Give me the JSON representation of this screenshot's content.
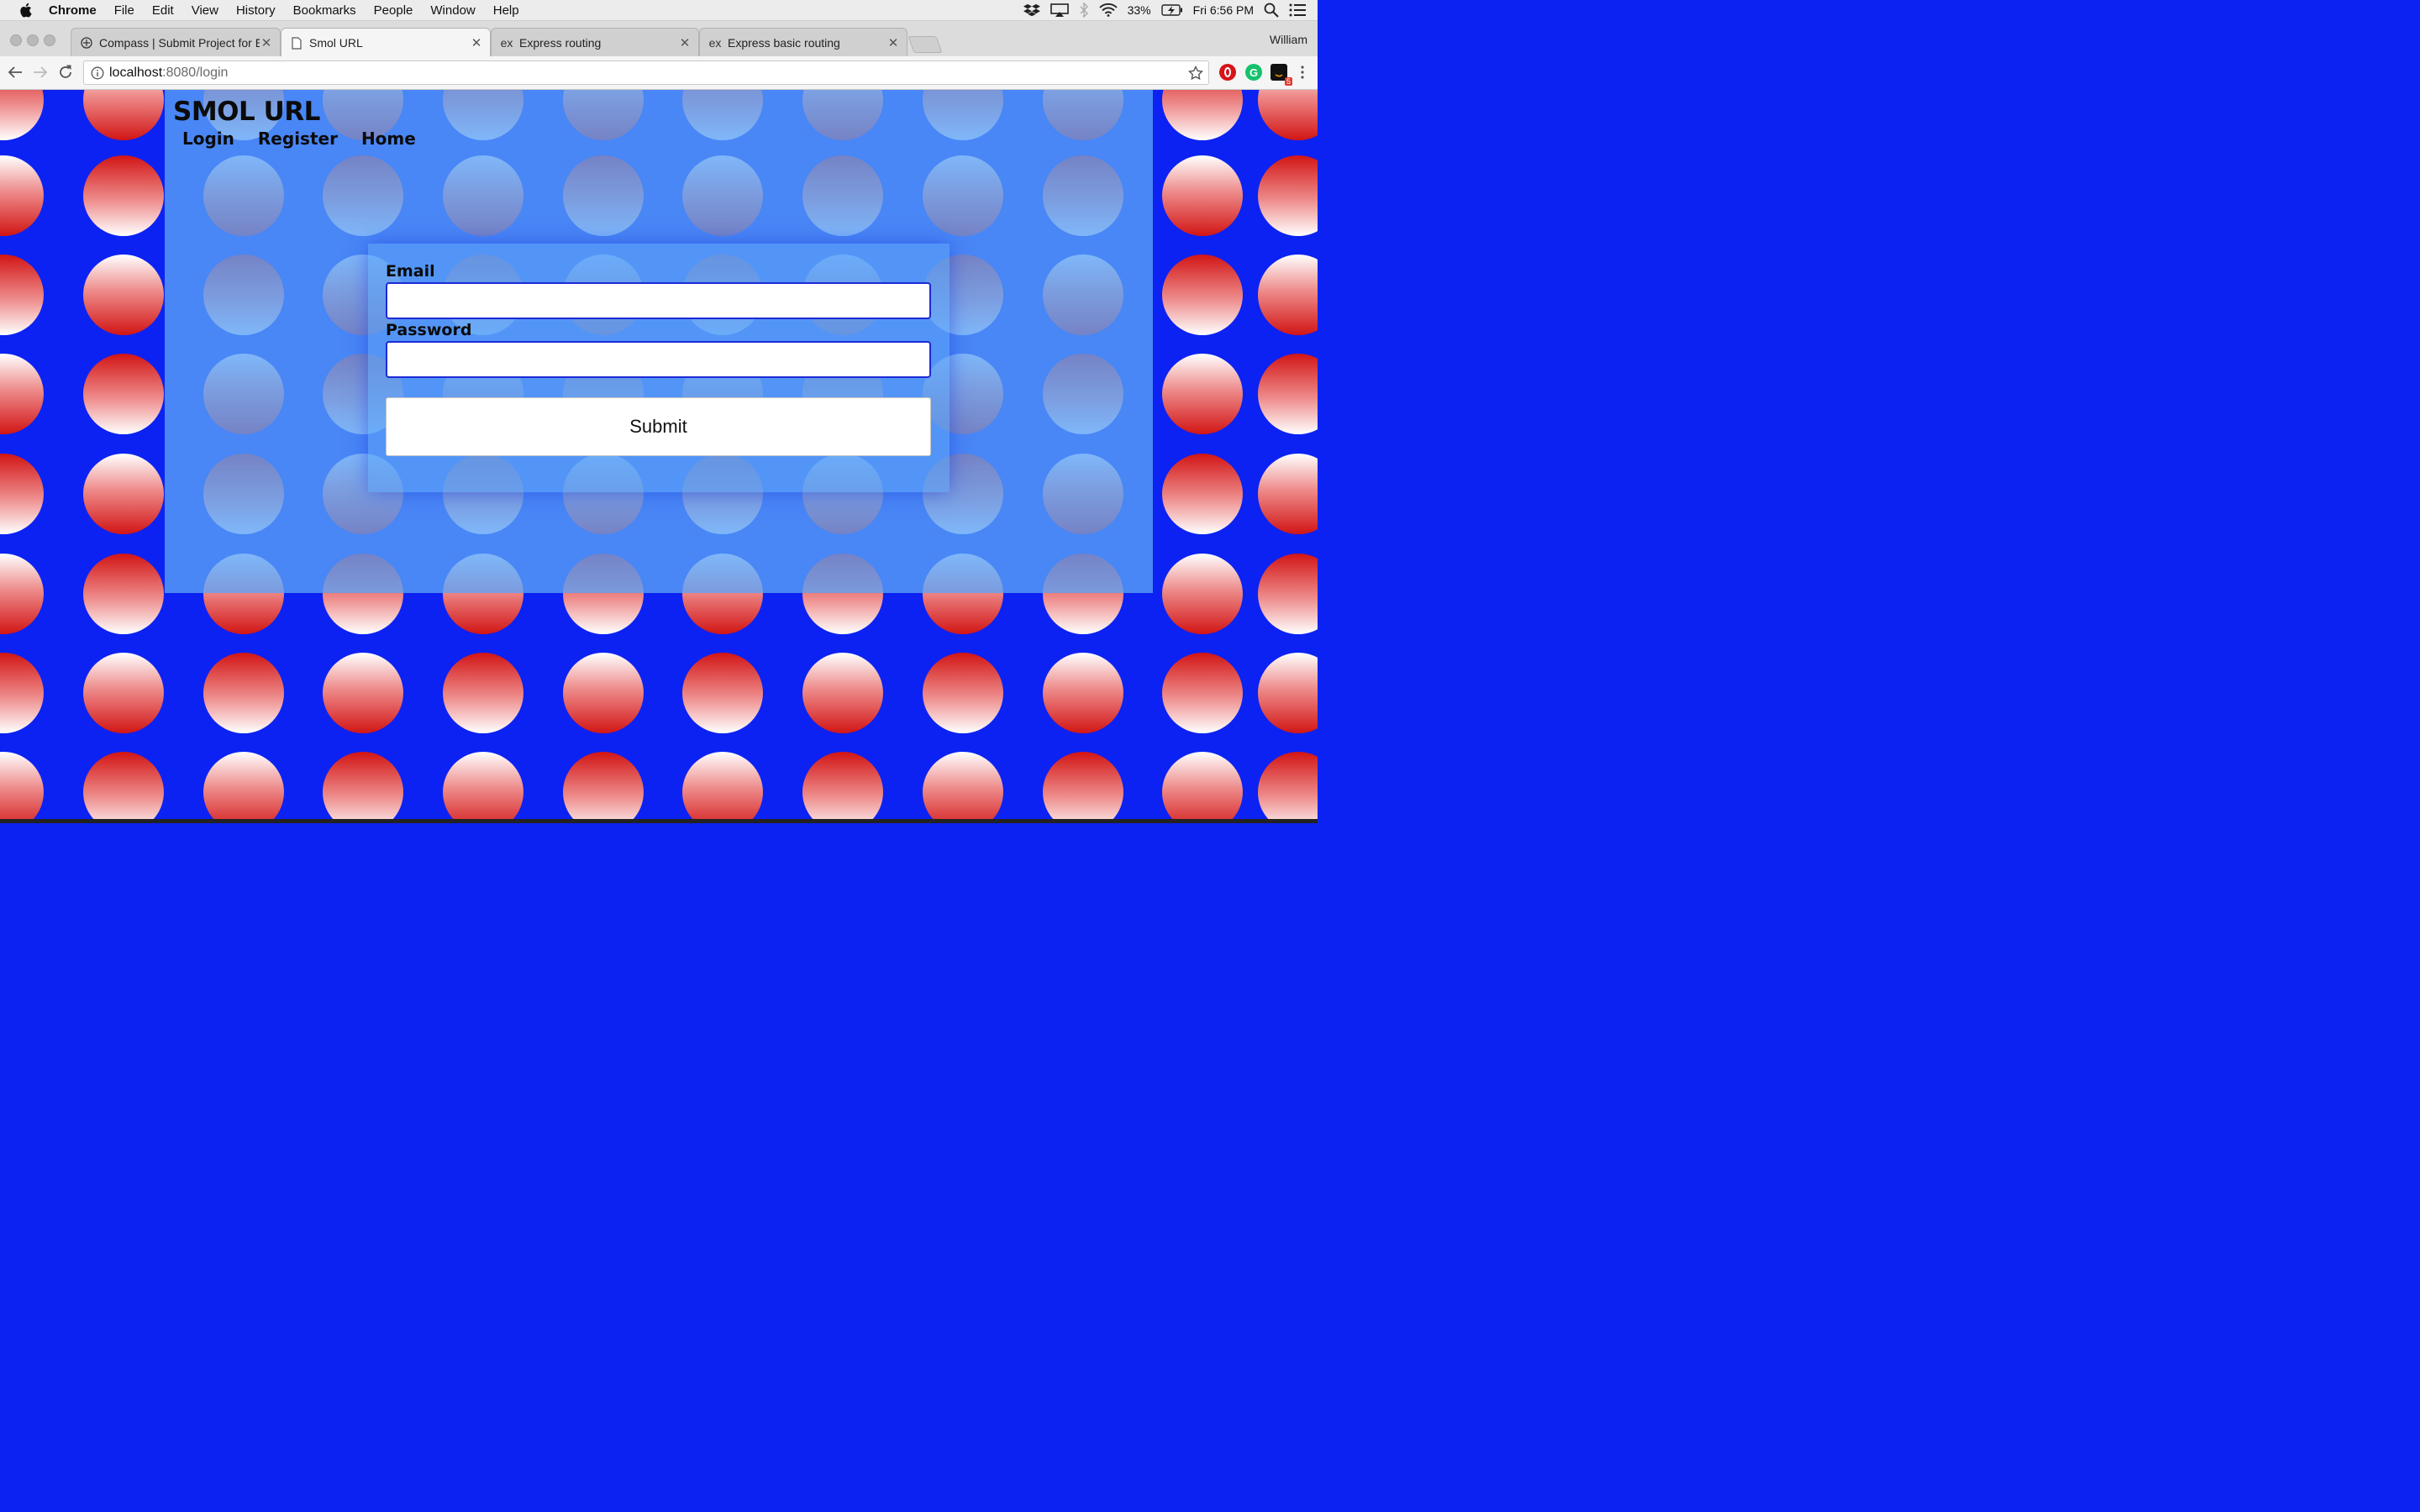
{
  "menubar": {
    "app": "Chrome",
    "items": [
      "File",
      "Edit",
      "View",
      "History",
      "Bookmarks",
      "People",
      "Window",
      "Help"
    ],
    "battery": "33%",
    "clock": "Fri 6:56 PM"
  },
  "tabs": [
    {
      "title": "Compass | Submit Project for E",
      "favicon": "compass-icon",
      "active": false
    },
    {
      "title": "Smol URL",
      "favicon": "page-icon",
      "active": true
    },
    {
      "title": "Express routing",
      "favicon": "ex",
      "active": false
    },
    {
      "title": "Express basic routing",
      "favicon": "ex",
      "active": false
    }
  ],
  "profile": "William",
  "toolbar": {
    "url_host": "localhost",
    "url_path": ":8080/login",
    "extension_badge": "5"
  },
  "page": {
    "brand": "SMOL URL",
    "nav": [
      "Login",
      "Register",
      "Home"
    ],
    "form": {
      "email_label": "Email",
      "email_value": "",
      "password_label": "Password",
      "password_value": "",
      "submit_label": "Submit"
    }
  },
  "colors": {
    "background_blue": "#0b22f2",
    "panel_blue": "#5ba3f7",
    "dot_red": "#d41a1a",
    "field_border": "#1d2ad6"
  }
}
